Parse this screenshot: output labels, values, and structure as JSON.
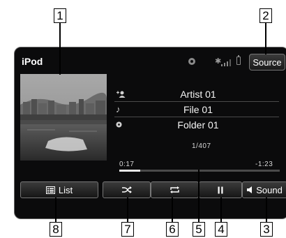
{
  "app": {
    "title": "iPod",
    "source_label": "Source"
  },
  "status": {
    "icons": [
      "disc-icon",
      "bluetooth-icon",
      "signal-icon",
      "battery-icon"
    ]
  },
  "track": {
    "artist": "Artist 01",
    "file": "File 01",
    "folder": "Folder 01",
    "count": "1/407"
  },
  "playback": {
    "elapsed": "0:17",
    "remaining": "-1:23",
    "progress_fraction": 0.13
  },
  "controls": {
    "list_label": "List",
    "sound_label": "Sound",
    "icons": [
      "shuffle-icon",
      "repeat-icon",
      "pause-icon",
      "speaker-icon"
    ]
  },
  "callouts": [
    "1",
    "2",
    "3",
    "4",
    "5",
    "6",
    "7",
    "8"
  ],
  "colors": {
    "screen_bg": "#0b0b0c",
    "button_border": "#777777",
    "progress_fill": "#e6e6e6"
  }
}
